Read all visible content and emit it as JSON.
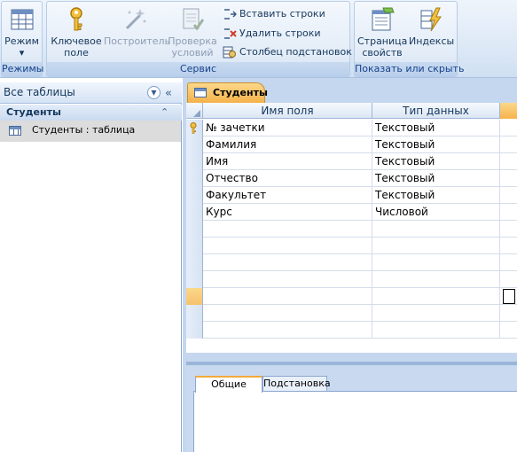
{
  "ribbon": {
    "groups": [
      {
        "label": "Режимы",
        "buttons": [
          {
            "label": "Режим",
            "icon": "view-grid-icon",
            "enabled": true
          }
        ]
      },
      {
        "label": "Сервис",
        "big_buttons": [
          {
            "line1": "Ключевое",
            "line2": "поле",
            "icon": "key-icon",
            "enabled": true
          },
          {
            "line1": "Построитель",
            "line2": "",
            "icon": "builder-wand-icon",
            "enabled": false
          },
          {
            "line1": "Проверка",
            "line2": "условий",
            "icon": "test-rules-icon",
            "enabled": false
          }
        ],
        "small_buttons": [
          {
            "label": "Вставить строки",
            "icon": "insert-rows-icon"
          },
          {
            "label": "Удалить строки",
            "icon": "delete-rows-icon"
          },
          {
            "label": "Столбец  подстановок",
            "icon": "lookup-column-icon"
          }
        ]
      },
      {
        "label": "Показать или скрыть",
        "big_buttons": [
          {
            "line1": "Страница",
            "line2": "свойств",
            "icon": "property-sheet-icon",
            "enabled": true
          },
          {
            "line1": "Индексы",
            "line2": "",
            "icon": "indexes-lightning-icon",
            "enabled": true
          }
        ]
      }
    ]
  },
  "nav": {
    "header": "Все таблицы",
    "group": "Студенты",
    "items": [
      {
        "label": "Студенты : таблица",
        "icon": "table-icon"
      }
    ]
  },
  "document": {
    "tab_label": "Студенты",
    "columns": {
      "field_name": "Имя поля",
      "data_type": "Тип данных"
    },
    "rows": [
      {
        "field": "№ зачетки",
        "type": "Текстовый",
        "primary_key": true
      },
      {
        "field": "Фамилия",
        "type": "Текстовый",
        "primary_key": false
      },
      {
        "field": "Имя",
        "type": "Текстовый",
        "primary_key": false
      },
      {
        "field": "Отчество",
        "type": "Текстовый",
        "primary_key": false
      },
      {
        "field": "Факультет",
        "type": "Текстовый",
        "primary_key": false
      },
      {
        "field": "Курс",
        "type": "Числовой",
        "primary_key": false
      }
    ],
    "empty_rows": 7,
    "active_row_index": 10
  },
  "properties": {
    "tabs": [
      {
        "label": "Общие",
        "active": true
      },
      {
        "label": "Подстановка",
        "active": false
      }
    ]
  },
  "colors": {
    "ribbon_bg": "#dfeaf7",
    "accent_orange": "#f5b24b",
    "nav_selected": "#dcdcdc",
    "work_bg": "#c5d7ee"
  }
}
